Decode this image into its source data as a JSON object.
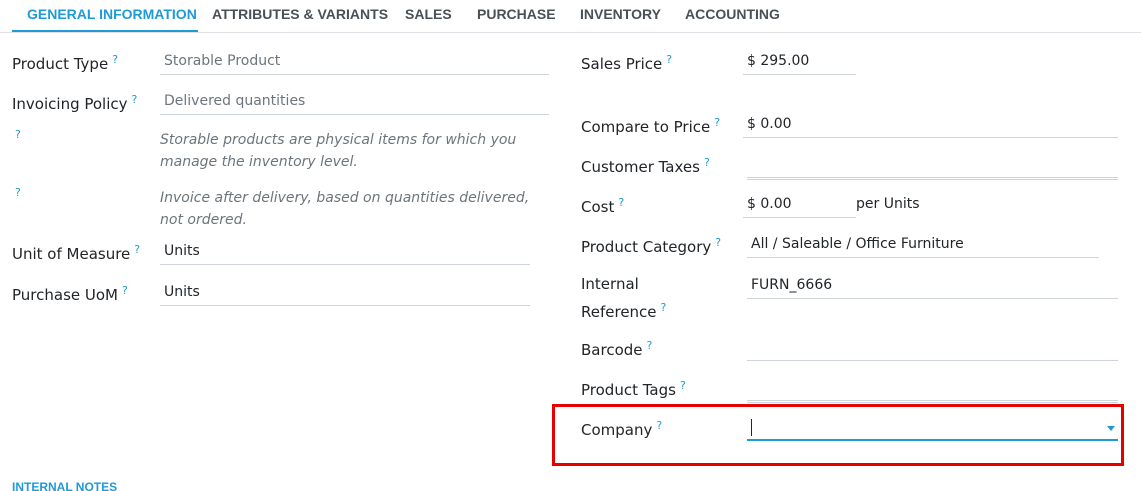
{
  "tabs": [
    {
      "label": "GENERAL INFORMATION",
      "active": true
    },
    {
      "label": "ATTRIBUTES & VARIANTS",
      "active": false
    },
    {
      "label": "SALES",
      "active": false
    },
    {
      "label": "PURCHASE",
      "active": false
    },
    {
      "label": "INVENTORY",
      "active": false
    },
    {
      "label": "ACCOUNTING",
      "active": false
    }
  ],
  "help_mark": "?",
  "left": {
    "product_type": {
      "label": "Product Type",
      "value": "Storable Product"
    },
    "invoicing_policy": {
      "label": "Invoicing Policy",
      "value": "Delivered quantities"
    },
    "note_storable": "Storable products are physical items for which you manage the inventory level.",
    "note_invoice": "Invoice after delivery, based on quantities delivered, not ordered.",
    "unit_of_measure": {
      "label": "Unit of Measure",
      "value": "Units"
    },
    "purchase_uom": {
      "label": "Purchase UoM",
      "value": "Units"
    }
  },
  "right": {
    "sales_price": {
      "label": "Sales Price",
      "value": "$ 295.00"
    },
    "compare_price": {
      "label": "Compare to Price",
      "value": "$ 0.00"
    },
    "customer_taxes": {
      "label": "Customer Taxes",
      "value": ""
    },
    "cost": {
      "label": "Cost",
      "value": "$ 0.00",
      "suffix": "per Units"
    },
    "product_category": {
      "label": "Product Category",
      "value": "All / Saleable / Office Furniture"
    },
    "internal_reference": {
      "label": "Internal Reference",
      "value": "FURN_6666"
    },
    "barcode": {
      "label": "Barcode",
      "value": ""
    },
    "product_tags": {
      "label": "Product Tags",
      "value": ""
    },
    "company": {
      "label": "Company",
      "value": ""
    }
  },
  "sections": {
    "internal_notes": "INTERNAL NOTES"
  },
  "colors": {
    "accent": "#1f9ad6",
    "highlight": "#e60000"
  }
}
